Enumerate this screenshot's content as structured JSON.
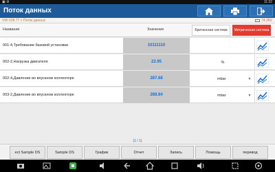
{
  "statusbar": {
    "left": "▣ ⚙",
    "right": "11:32"
  },
  "title": "Поток данных",
  "breadcrumb": "VW V28.77 > Поток данных",
  "voltage": "74.26V",
  "header": {
    "name_label": "Название",
    "value_label": "Значение",
    "british_label": "Британская система",
    "metric_label": "Метрическая система"
  },
  "rows": [
    {
      "name": "001-4,Требование базовой установки",
      "value": "10111110",
      "unit": ""
    },
    {
      "name": "002-2,Нагрузка двигателя",
      "value": "22.95",
      "unit": "%"
    },
    {
      "name": "002-4,Давление во впускном коллекторе",
      "value": "287.68",
      "unit": "mbar"
    },
    {
      "name": "003-2,Давление во впускном коллекторе",
      "value": "288.84",
      "unit": "mbar"
    }
  ],
  "pager": "(1 / 1)",
  "toolbar": {
    "select_ds": "ect Sample DS",
    "sample_ds": "Sample DS",
    "graph": "График",
    "report": "Отчет",
    "record": "Запись",
    "help": "Помощь",
    "translate": "перевод"
  },
  "colors": {
    "titlebar": "#1c5a99",
    "metric_active": "#e53a2f",
    "value_text": "#1a6fd0"
  }
}
